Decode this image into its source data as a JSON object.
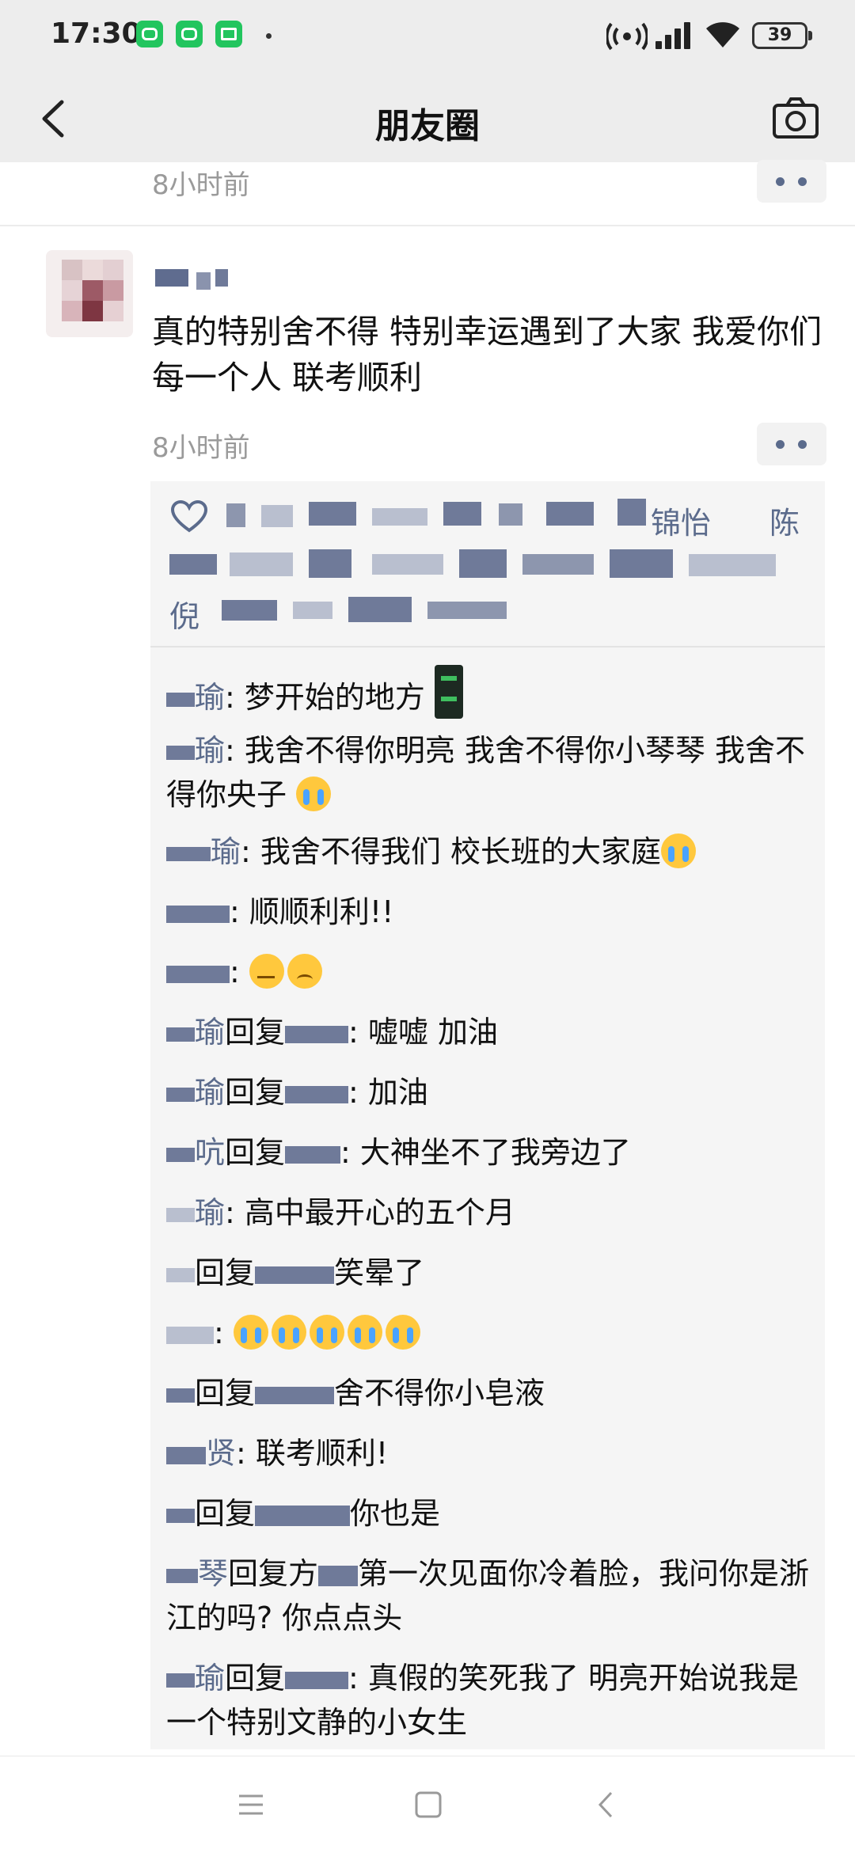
{
  "status_bar": {
    "time": "17:30",
    "battery": "39",
    "icons": [
      "wechat-icon",
      "wechat-mini-icon",
      "home-app-icon",
      "hotspot-icon",
      "signal-icon",
      "wifi-icon",
      "battery-icon"
    ]
  },
  "nav": {
    "title": "朋友圈",
    "back_icon": "chevron-left-icon",
    "camera_icon": "camera-icon"
  },
  "prev_post": {
    "time": "8小时前"
  },
  "post": {
    "text": "真的特别舍不得 特别幸运遇到了大家 我爱你们每一个人 联考顺利",
    "time": "8小时前",
    "likes_visible": [
      "锦怡",
      "陈",
      "倪"
    ]
  },
  "comments": [
    {
      "who": "瑜",
      "text": ": 梦开始的地方"
    },
    {
      "who": "瑜",
      "text": ": 我舍不得你明亮 我舍不得你小琴琴 我舍不得你央子"
    },
    {
      "who": "瑜",
      "text": ": 我舍不得我们 校长班的大家庭"
    },
    {
      "who": "",
      "text": ": 顺顺利利!!"
    },
    {
      "who": "",
      "text": ": "
    },
    {
      "who": "瑜",
      "reply": "回复",
      "text": ": 嘘嘘 加油"
    },
    {
      "who": "瑜",
      "reply": "回复",
      "text": ": 加油"
    },
    {
      "who": "吭",
      "reply": "回复",
      "text": ": 大神坐不了我旁边了"
    },
    {
      "who": "瑜",
      "text": ": 高中最开心的五个月"
    },
    {
      "who": "",
      "reply": "回复",
      "text": "笑晕了"
    },
    {
      "who": "",
      "text": ": "
    },
    {
      "who": "",
      "reply": "回复",
      "text": "舍不得你小皂液"
    },
    {
      "who": "贤",
      "text": ": 联考顺利!"
    },
    {
      "who": "",
      "reply": "回复",
      "text": "你也是"
    },
    {
      "who": "琴",
      "reply": "回复方",
      "text": "第一次见面你冷着脸，我问你是浙江的吗? 你点点头"
    },
    {
      "who": "瑜",
      "reply": "回复",
      "text": ": 真假的笑死我了 明亮开始说我是一个特别文静的小女生"
    }
  ]
}
